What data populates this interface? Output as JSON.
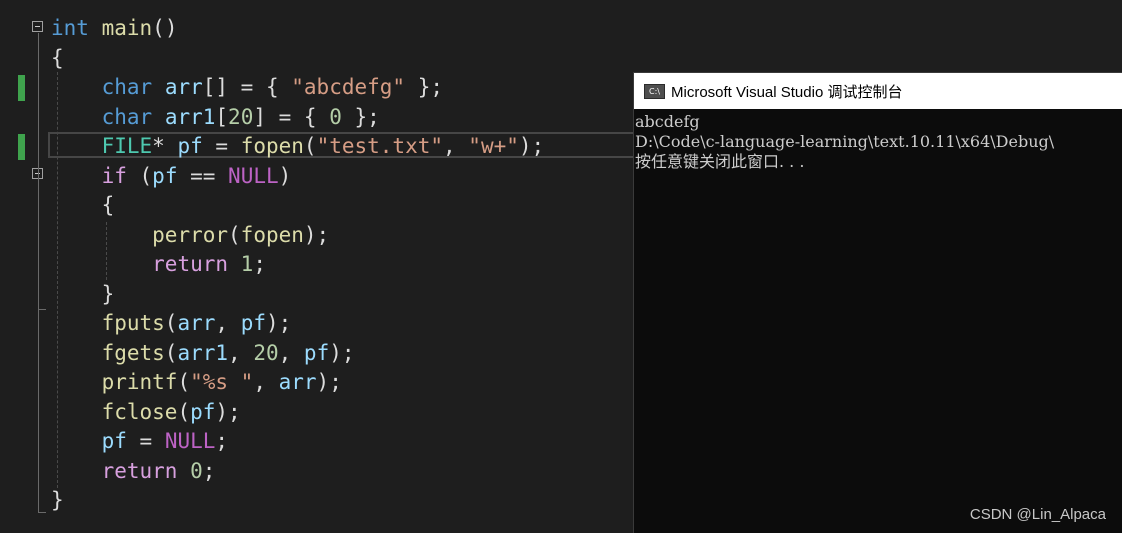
{
  "editor": {
    "lines": [
      [
        [
          "kw",
          "int"
        ],
        [
          "pl",
          " "
        ],
        [
          "fn",
          "main"
        ],
        [
          "pl",
          "()"
        ]
      ],
      [
        [
          "pl",
          "{"
        ]
      ],
      [
        [
          "pl",
          "    "
        ],
        [
          "kw",
          "char"
        ],
        [
          "pl",
          " "
        ],
        [
          "id",
          "arr"
        ],
        [
          "pl",
          "[] = { "
        ],
        [
          "str",
          "\"abcdefg\""
        ],
        [
          "pl",
          " };"
        ]
      ],
      [
        [
          "pl",
          "    "
        ],
        [
          "kw",
          "char"
        ],
        [
          "pl",
          " "
        ],
        [
          "id",
          "arr1"
        ],
        [
          "pl",
          "["
        ],
        [
          "num",
          "20"
        ],
        [
          "pl",
          "] = { "
        ],
        [
          "num",
          "0"
        ],
        [
          "pl",
          " };"
        ]
      ],
      [
        [
          "pl",
          "    "
        ],
        [
          "ty",
          "FILE"
        ],
        [
          "pl",
          "* "
        ],
        [
          "id",
          "pf"
        ],
        [
          "pl",
          " = "
        ],
        [
          "fn",
          "fopen"
        ],
        [
          "pl",
          "("
        ],
        [
          "str",
          "\"test.txt\""
        ],
        [
          "pl",
          ", "
        ],
        [
          "str",
          "\"w+\""
        ],
        [
          "pl",
          ");"
        ]
      ],
      [
        [
          "pl",
          "    "
        ],
        [
          "ctl",
          "if"
        ],
        [
          "pl",
          " ("
        ],
        [
          "id",
          "pf"
        ],
        [
          "pl",
          " == "
        ],
        [
          "mac",
          "NULL"
        ],
        [
          "pl",
          ")"
        ]
      ],
      [
        [
          "pl",
          "    {"
        ]
      ],
      [
        [
          "pl",
          "        "
        ],
        [
          "fn",
          "perror"
        ],
        [
          "pl",
          "("
        ],
        [
          "fn",
          "fopen"
        ],
        [
          "pl",
          ");"
        ]
      ],
      [
        [
          "pl",
          "        "
        ],
        [
          "ctl",
          "return"
        ],
        [
          "pl",
          " "
        ],
        [
          "num",
          "1"
        ],
        [
          "pl",
          ";"
        ]
      ],
      [
        [
          "pl",
          "    }"
        ]
      ],
      [
        [
          "pl",
          "    "
        ],
        [
          "fn",
          "fputs"
        ],
        [
          "pl",
          "("
        ],
        [
          "id",
          "arr"
        ],
        [
          "pl",
          ", "
        ],
        [
          "id",
          "pf"
        ],
        [
          "pl",
          ");"
        ]
      ],
      [
        [
          "pl",
          "    "
        ],
        [
          "fn",
          "fgets"
        ],
        [
          "pl",
          "("
        ],
        [
          "id",
          "arr1"
        ],
        [
          "pl",
          ", "
        ],
        [
          "num",
          "20"
        ],
        [
          "pl",
          ", "
        ],
        [
          "id",
          "pf"
        ],
        [
          "pl",
          ");"
        ]
      ],
      [
        [
          "pl",
          "    "
        ],
        [
          "fn",
          "printf"
        ],
        [
          "pl",
          "("
        ],
        [
          "str",
          "\"%s \""
        ],
        [
          "pl",
          ", "
        ],
        [
          "id",
          "arr"
        ],
        [
          "pl",
          ");"
        ]
      ],
      [
        [
          "pl",
          "    "
        ],
        [
          "fn",
          "fclose"
        ],
        [
          "pl",
          "("
        ],
        [
          "id",
          "pf"
        ],
        [
          "pl",
          ");"
        ]
      ],
      [
        [
          "pl",
          "    "
        ],
        [
          "id",
          "pf"
        ],
        [
          "pl",
          " = "
        ],
        [
          "mac",
          "NULL"
        ],
        [
          "pl",
          ";"
        ]
      ],
      [
        [
          "pl",
          "    "
        ],
        [
          "ctl",
          "return"
        ],
        [
          "pl",
          " "
        ],
        [
          "num",
          "0"
        ],
        [
          "pl",
          ";"
        ]
      ],
      [
        [
          "pl",
          "}"
        ]
      ]
    ],
    "changed_line_color": "#3fa34d"
  },
  "console": {
    "title": "Microsoft Visual Studio 调试控制台",
    "icon_label": "C:\\",
    "output": [
      "abcdefg",
      "D:\\Code\\c-language-learning\\text.10.11\\x64\\Debug\\",
      "按任意键关闭此窗口. . ."
    ]
  },
  "watermark": "CSDN @Lin_Alpaca"
}
